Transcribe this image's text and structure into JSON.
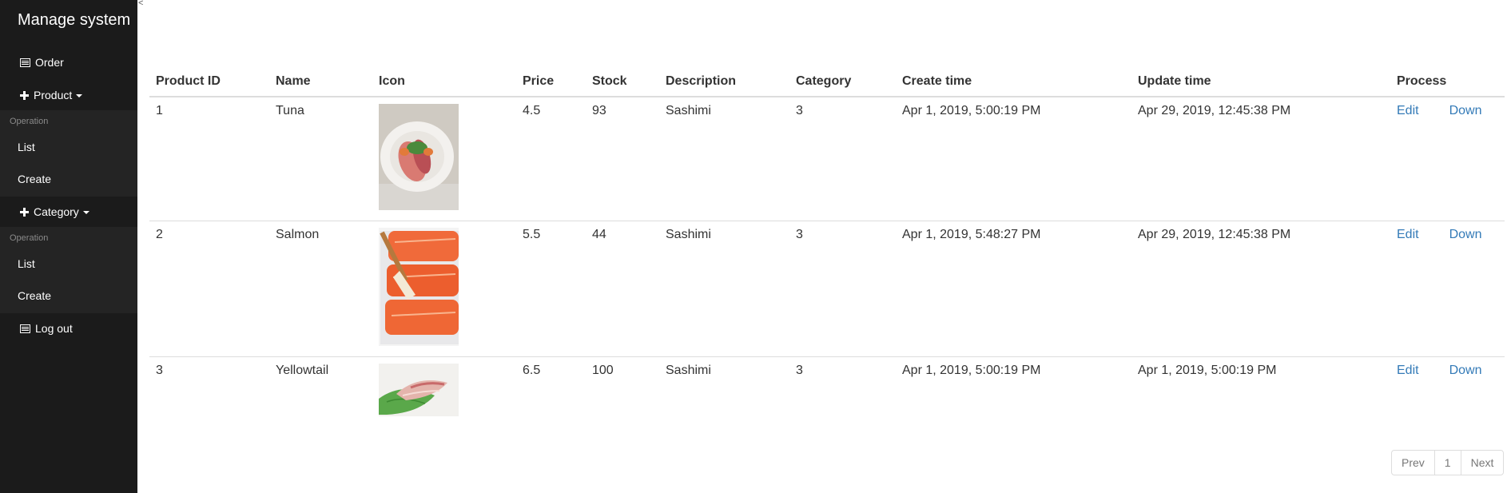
{
  "sidebar": {
    "brand": "Manage system",
    "toggle_glyph": "<",
    "order_label": "Order",
    "product": {
      "label": "Product",
      "section_header": "Operation",
      "items": [
        "List",
        "Create"
      ]
    },
    "category": {
      "label": "Category",
      "section_header": "Operation",
      "items": [
        "List",
        "Create"
      ]
    },
    "logout_label": "Log out"
  },
  "table": {
    "headers": [
      "Product ID",
      "Name",
      "Icon",
      "Price",
      "Stock",
      "Description",
      "Category",
      "Create time",
      "Update time",
      "Process"
    ],
    "rows": [
      {
        "id": "1",
        "name": "Tuna",
        "icon": "tuna-sashimi-photo",
        "price": "4.5",
        "stock": "93",
        "description": "Sashimi",
        "category": "3",
        "create_time": "Apr 1, 2019, 5:00:19 PM",
        "update_time": "Apr 29, 2019, 12:45:38 PM",
        "edit": "Edit",
        "down": "Down"
      },
      {
        "id": "2",
        "name": "Salmon",
        "icon": "salmon-fillet-photo",
        "price": "5.5",
        "stock": "44",
        "description": "Sashimi",
        "category": "3",
        "create_time": "Apr 1, 2019, 5:48:27 PM",
        "update_time": "Apr 29, 2019, 12:45:38 PM",
        "edit": "Edit",
        "down": "Down"
      },
      {
        "id": "3",
        "name": "Yellowtail",
        "icon": "yellowtail-sashimi-photo",
        "price": "6.5",
        "stock": "100",
        "description": "Sashimi",
        "category": "3",
        "create_time": "Apr 1, 2019, 5:00:19 PM",
        "update_time": "Apr 1, 2019, 5:00:19 PM",
        "edit": "Edit",
        "down": "Down"
      }
    ]
  },
  "pagination": {
    "prev": "Prev",
    "page": "1",
    "next": "Next"
  },
  "colors": {
    "sidebar_bg": "#1b1b1b",
    "subpanel_bg": "#242424",
    "link": "#337ab7"
  }
}
